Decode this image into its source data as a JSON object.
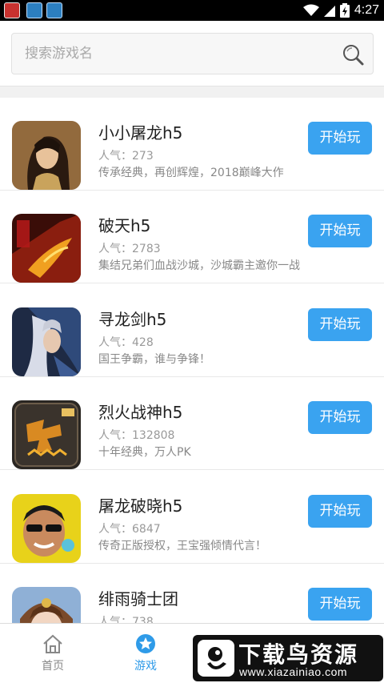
{
  "status_bar": {
    "time": "4:27",
    "icons": [
      "app-icon-red",
      "app-icon-blue",
      "app-icon-blue",
      "wifi-icon",
      "signal-icon",
      "battery-icon"
    ]
  },
  "search": {
    "placeholder": "搜索游戏名",
    "value": "",
    "icon": "search-icon"
  },
  "games": [
    {
      "name": "小小屠龙h5",
      "popularity": "人气：273",
      "description": "传承经典，再创辉煌，2018巅峰大作",
      "button": "开始玩",
      "icon": "warrior-woman-icon"
    },
    {
      "name": "破天h5",
      "popularity": "人气：2783",
      "description": "集结兄弟们血战沙城，沙城霸主邀你一战",
      "button": "开始玩",
      "icon": "dragon-warrior-icon"
    },
    {
      "name": "寻龙剑h5",
      "popularity": "人气：428",
      "description": "国王争霸，谁与争锋！",
      "button": "开始玩",
      "icon": "swordsman-icon"
    },
    {
      "name": "烈火战神h5",
      "popularity": "人气：132808",
      "description": "十年经典，万人PK",
      "button": "开始玩",
      "icon": "fire-character-icon"
    },
    {
      "name": "屠龙破晓h5",
      "popularity": "人气：6847",
      "description": "传奇正版授权，王宝强倾情代言！",
      "button": "开始玩",
      "icon": "actor-face-icon"
    },
    {
      "name": "绯雨骑士团",
      "popularity": "人气：738",
      "description": "",
      "button": "开始玩",
      "icon": "anime-girl-icon"
    }
  ],
  "bottom_nav": {
    "tabs": [
      {
        "label": "首页",
        "icon": "home-icon",
        "active": false
      },
      {
        "label": "游戏",
        "icon": "star-icon",
        "active": true
      }
    ]
  },
  "watermark": {
    "title": "下载鸟资源",
    "url": "www.xiazainiao.com"
  },
  "colors": {
    "accent": "#3aa3f0",
    "text_primary": "#222222",
    "text_secondary": "#999999",
    "background": "#ffffff",
    "divider": "#e8e8e8"
  }
}
